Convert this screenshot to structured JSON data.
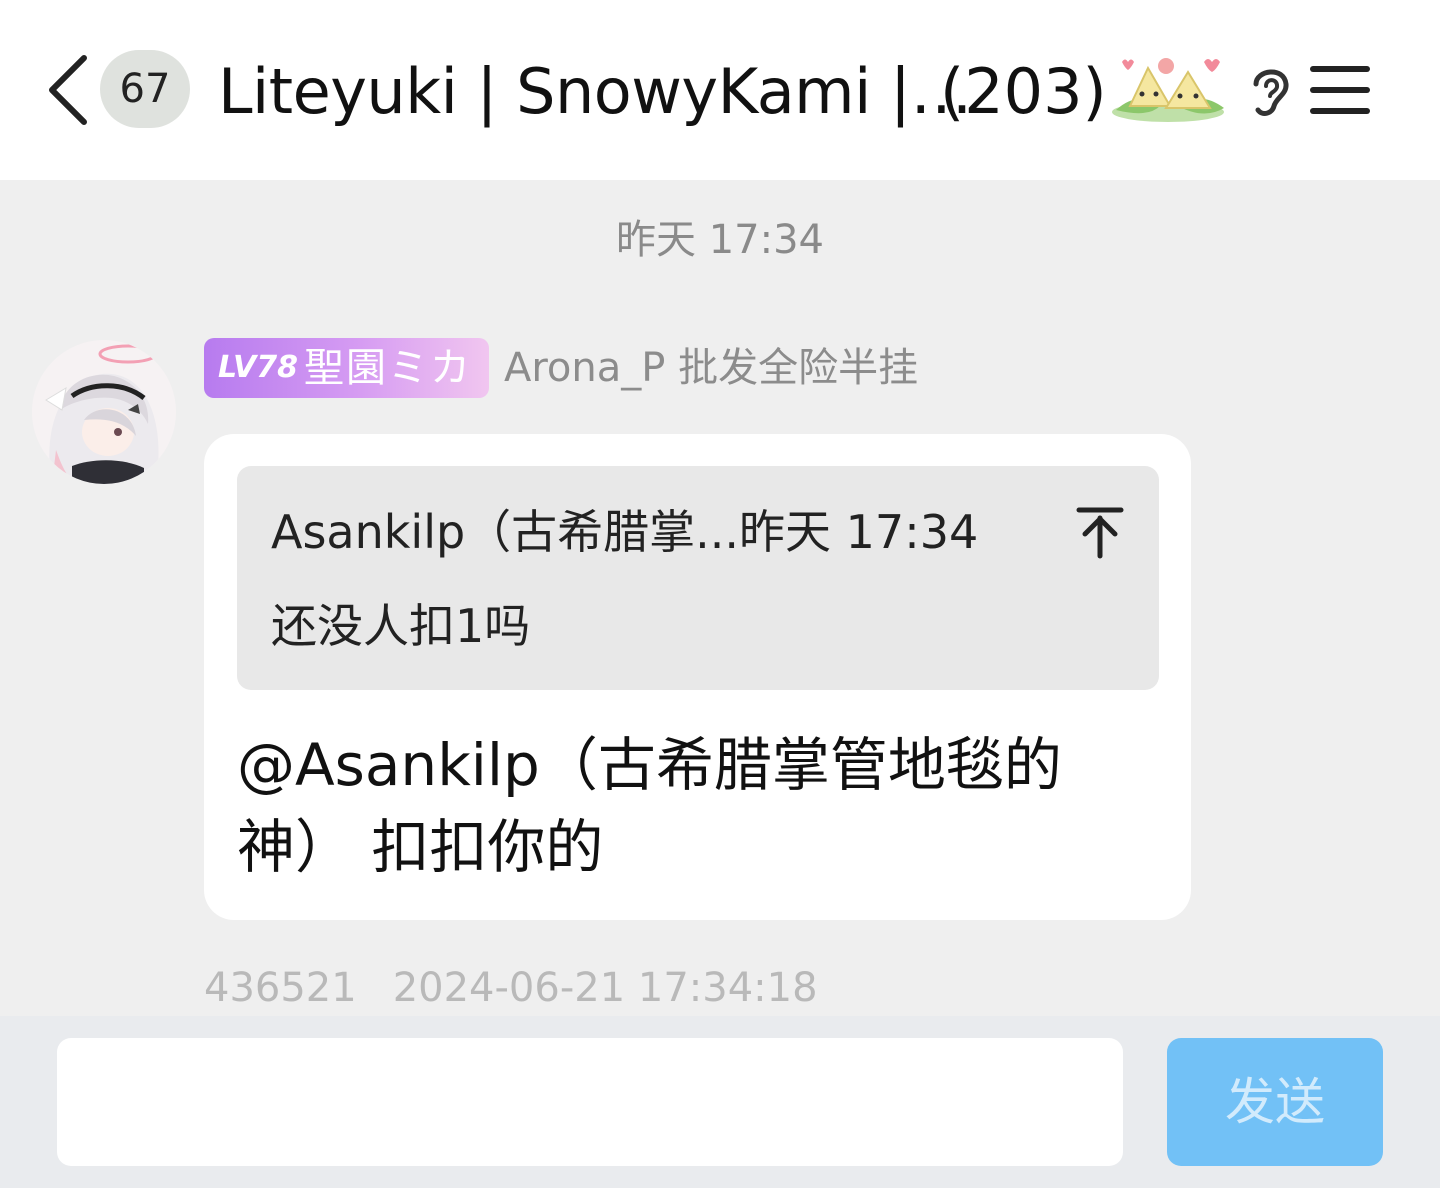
{
  "header": {
    "unread_count": "67",
    "title": "Liteyuki | SnowyKami |…",
    "member_count": "(203)",
    "icons": [
      "back-icon",
      "mascot-icon",
      "ear-icon",
      "menu-icon"
    ]
  },
  "chat": {
    "time_divider": "昨天 17:34",
    "message": {
      "level_label": "LV78",
      "level_title": "聖園ミカ",
      "sender": "Arona_P 批发全险半挂",
      "quote": {
        "header": "Asankilp（古希腊掌...昨天 17:34",
        "text": "还没人扣1吗"
      },
      "text": "@Asankilp（古希腊掌管地毯的神） 扣扣你的",
      "meta_id": "436521",
      "meta_time": "2024-06-21 17:34:18"
    }
  },
  "input": {
    "value": "",
    "send_label": "发送"
  },
  "colors": {
    "header_bg": "#ffffff",
    "chat_bg": "#efefef",
    "send_button": "#72c1f6",
    "level_badge": "#b77bef"
  }
}
